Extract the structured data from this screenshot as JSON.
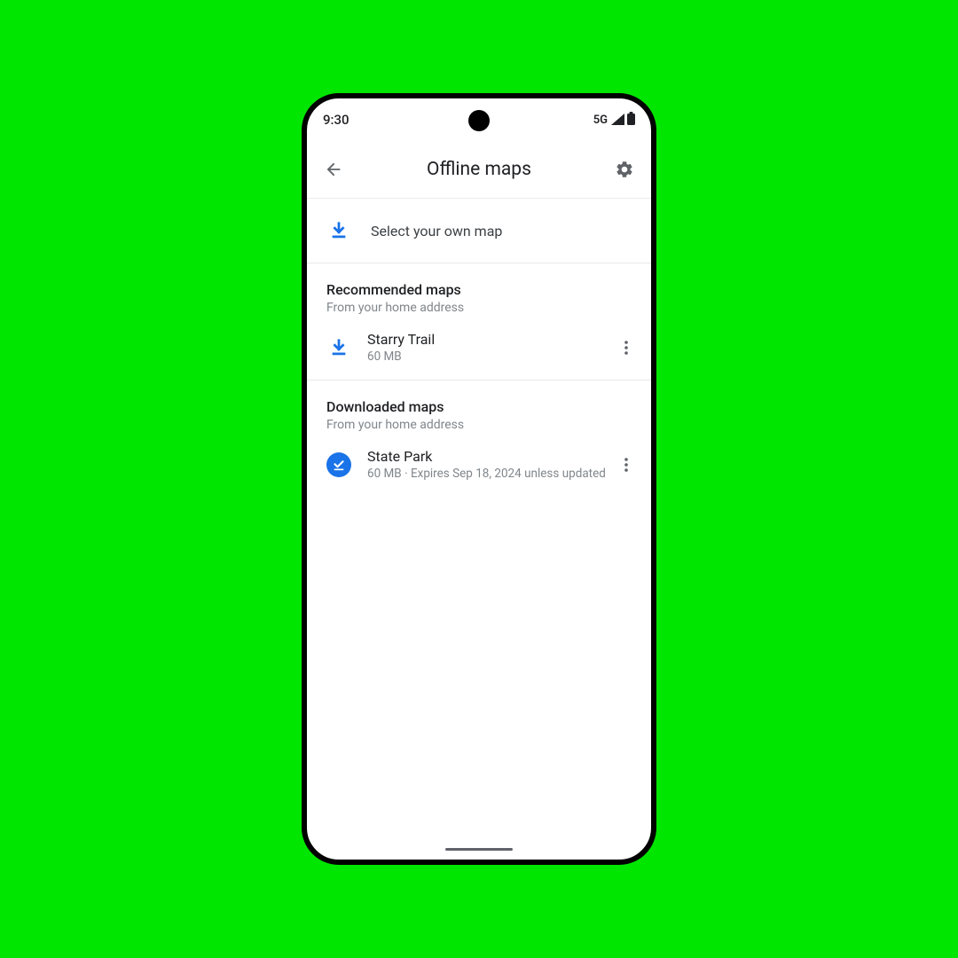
{
  "status": {
    "time": "9:30",
    "net": "5G"
  },
  "header": {
    "title": "Offline maps"
  },
  "select": {
    "label": "Select your own map"
  },
  "recommended": {
    "title": "Recommended maps",
    "subtitle": "From your home address",
    "item": {
      "name": "Starry Trail",
      "meta": "60 MB"
    }
  },
  "downloaded": {
    "title": "Downloaded maps",
    "subtitle": "From your home address",
    "item": {
      "name": "State Park",
      "meta": "60  MB · Expires Sep 18, 2024 unless updated"
    }
  }
}
